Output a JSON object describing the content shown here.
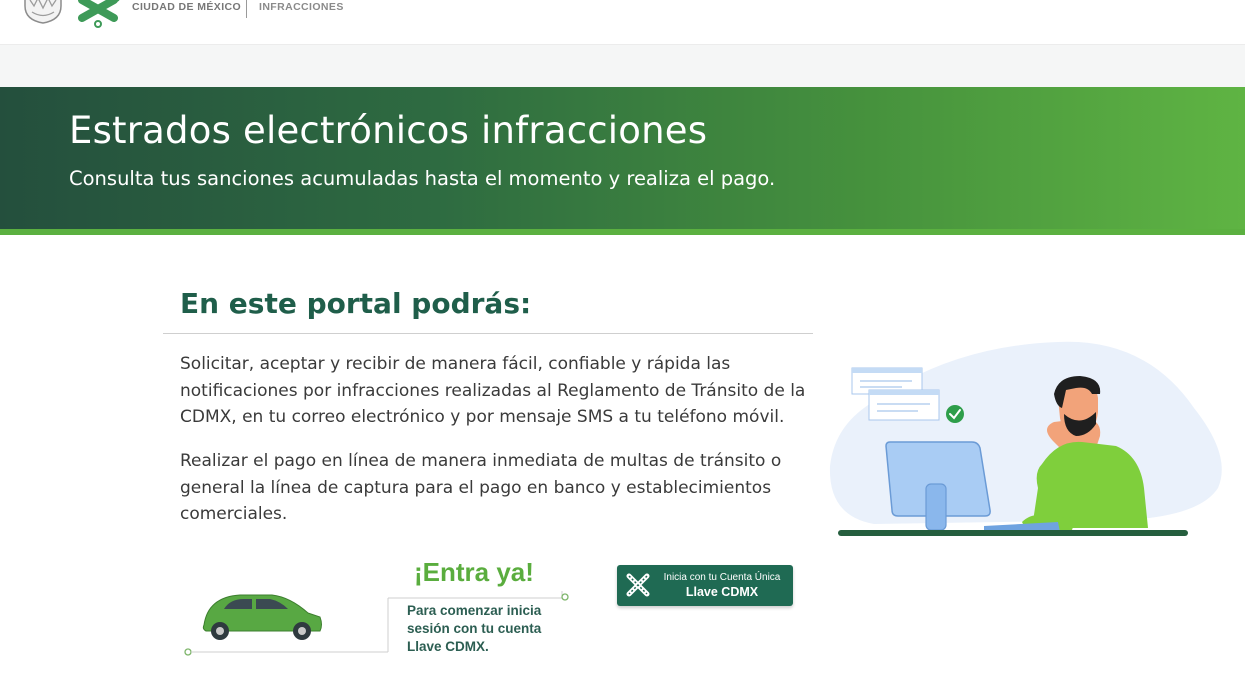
{
  "header": {
    "city_label": "CIUDAD DE MÉXICO",
    "section_label": "INFRACCIONES"
  },
  "banner": {
    "title": "Estrados electrónicos infracciones",
    "subtitle": "Consulta tus sanciones acumuladas hasta el momento y realiza el pago."
  },
  "main": {
    "heading": "En este portal podrás:",
    "paragraphs": [
      "Solicitar, aceptar y recibir de manera fácil, confiable y rápida las notificaciones por infracciones realizadas al Reglamento de Tránsito de la CDMX, en tu correo electrónico y por mensaje SMS a tu teléfono móvil.",
      "Realizar el pago en línea de manera inmediata de multas de tránsito o general la línea de captura para el pago en banco y establecimientos comerciales."
    ]
  },
  "promo": {
    "title": "¡Entra ya!",
    "text": "Para comenzar inicia sesión con tu cuenta Llave CDMX."
  },
  "llave_button": {
    "line1": "Inicia con tu Cuenta Única",
    "line2": "Llave CDMX"
  },
  "icons": {
    "emblem": "coat-of-arms-icon",
    "logo": "cdmx-logo-icon",
    "car": "car-icon",
    "button": "llave-logo-icon",
    "check": "check-circle-icon"
  },
  "colors": {
    "brand_dark_green": "#1f5e4a",
    "brand_green": "#5aad3e",
    "banner_start": "#244f3d",
    "banner_end": "#5fb443",
    "button_bg": "#1f6a53"
  }
}
